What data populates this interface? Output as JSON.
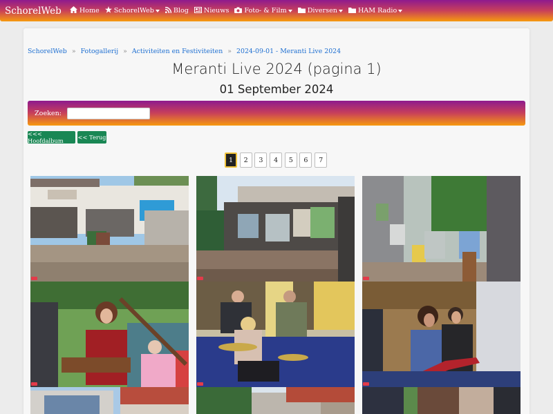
{
  "nav": {
    "brand": "SchorelWeb",
    "items": [
      {
        "icon": "home-icon",
        "label": "Home",
        "dropdown": false
      },
      {
        "icon": "star-icon",
        "label": "SchorelWeb",
        "dropdown": true
      },
      {
        "icon": "rss-icon",
        "label": "Blog",
        "dropdown": false
      },
      {
        "icon": "newspaper-icon",
        "label": "Nieuws",
        "dropdown": false
      },
      {
        "icon": "camera-icon",
        "label": "Foto- & Film",
        "dropdown": true
      },
      {
        "icon": "folder-icon",
        "label": "Diversen",
        "dropdown": true
      },
      {
        "icon": "folder-icon",
        "label": "HAM Radio",
        "dropdown": true
      }
    ]
  },
  "breadcrumb": [
    "SchorelWeb",
    "Fotogallerij",
    "Activiteiten en Festiviteiten",
    "2024-09-01 - Meranti Live 2024"
  ],
  "page": {
    "title": "Meranti Live 2024 (pagina 1)",
    "date": "01 September 2024"
  },
  "search": {
    "label": "Zoeken:",
    "value": ""
  },
  "buttons": {
    "main_album": "<<< Hoofdalbum",
    "back": "<< Terug"
  },
  "pagination": {
    "pages": [
      "1",
      "2",
      "3",
      "4",
      "5",
      "6",
      "7"
    ],
    "active": "1"
  },
  "colors": {
    "nav_gradient_top": "#8e1a8e",
    "nav_gradient_bottom": "#f79a0e",
    "link": "#1e6fd1",
    "button_green": "#198754"
  }
}
